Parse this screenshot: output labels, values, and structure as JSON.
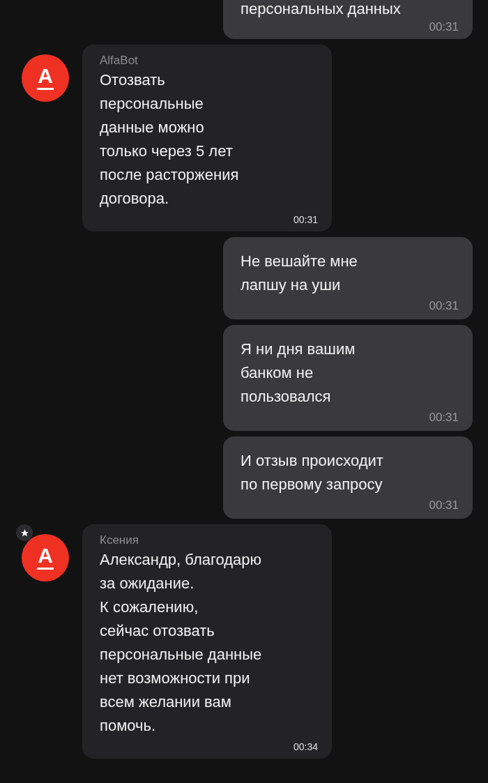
{
  "messages": [
    {
      "kind": "outgoing",
      "lines": [
        "персональных данных"
      ],
      "time": "00:31"
    },
    {
      "kind": "incoming",
      "sender": "AlfaBot",
      "avatar": {
        "letter": "А",
        "starred": false
      },
      "lines": [
        "Отозвать",
        "персональные",
        "данные можно",
        "только через 5 лет",
        "после расторжения",
        "договора."
      ],
      "time": "00:31"
    },
    {
      "kind": "outgoing",
      "lines": [
        "Не вешайте мне",
        "лапшу на уши"
      ],
      "time": "00:31"
    },
    {
      "kind": "outgoing",
      "lines": [
        "Я ни дня вашим",
        "банком не",
        "пользовался"
      ],
      "time": "00:31"
    },
    {
      "kind": "outgoing",
      "lines": [
        "И отзыв происходит",
        "по первому запросу"
      ],
      "time": "00:31"
    },
    {
      "kind": "incoming",
      "sender": "Ксения",
      "avatar": {
        "letter": "А",
        "starred": true
      },
      "lines": [
        "Александр, благодарю",
        "за ожидание.",
        "К сожалению,",
        "сейчас отозвать",
        "персональные данные",
        "нет возможности при",
        "всем желании вам",
        "помочь."
      ],
      "time": "00:34"
    }
  ]
}
